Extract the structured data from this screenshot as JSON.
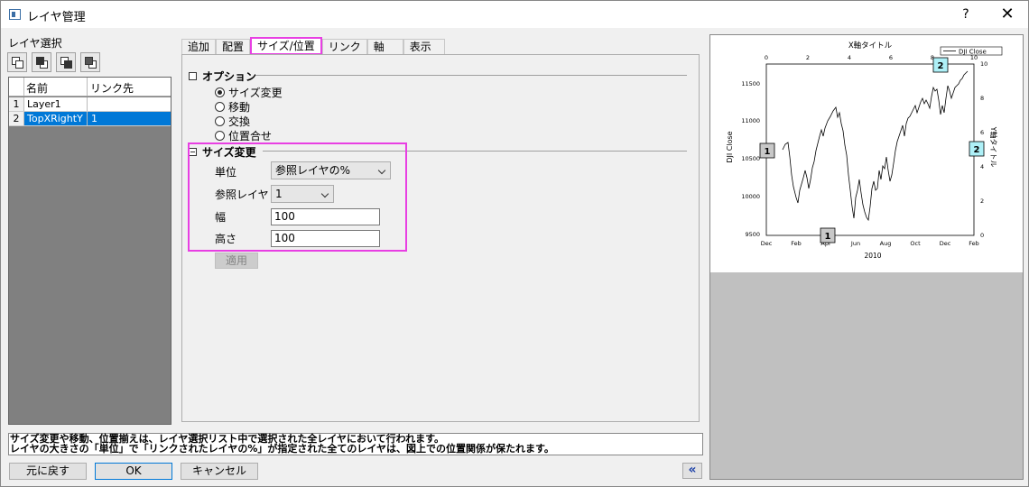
{
  "window": {
    "title": "レイヤ管理",
    "help": "?",
    "close": "✕"
  },
  "left": {
    "label": "レイヤ選択",
    "grid": {
      "headers": [
        "名前",
        "リンク先"
      ],
      "rows": [
        {
          "num": "1",
          "name": "Layer1",
          "link": ""
        },
        {
          "num": "2",
          "name": "TopXRightY",
          "link": "1"
        }
      ]
    }
  },
  "tabs": [
    "追加",
    "配置",
    "サイズ/位置",
    "リンク",
    "軸",
    "表示"
  ],
  "options": {
    "heading": "オプション",
    "items": [
      "サイズ変更",
      "移動",
      "交換",
      "位置合せ"
    ],
    "selected": 0
  },
  "resize": {
    "heading": "サイズ変更",
    "unit_label": "単位",
    "unit_value": "参照レイヤの%",
    "ref_label": "参照レイヤ",
    "ref_value": "1",
    "width_label": "幅",
    "width_value": "100",
    "height_label": "高さ",
    "height_value": "100",
    "apply": "適用"
  },
  "message": {
    "line1": "サイズ変更や移動、位置揃えは、レイヤ選択リスト中で選択された全レイヤにおいて行われます。",
    "line2": "レイヤの大きさの「単位」で「リンクされたレイヤの%」が指定された全てのレイヤは、図上での位置関係が保たれます。"
  },
  "buttons": {
    "reset": "元に戻す",
    "ok": "OK",
    "cancel": "キャンセル",
    "collapse": "«"
  },
  "preview": {
    "top_axis_title": "X軸タイトル",
    "legend": "DJI Close",
    "left_axis_title": "DJI Close",
    "right_axis_title": "Y軸タイトル",
    "bottom_axis_title": "2010",
    "left_ticks": [
      "11500",
      "11000",
      "10500",
      "10000",
      "9500"
    ],
    "right_ticks": [
      "10",
      "8",
      "6",
      "4",
      "2",
      "0"
    ],
    "top_ticks": [
      "0",
      "2",
      "4",
      "6",
      "8",
      "10"
    ],
    "bottom_ticks": [
      "Dec",
      "Feb",
      "Apr",
      "Jun",
      "Aug",
      "Oct",
      "Dec",
      "Feb"
    ],
    "layer1_tag": "1",
    "layer2_tag": "2",
    "colors": {
      "layer2_tag": "#aef0f7",
      "layer1_tag": "#c8c8c8"
    }
  }
}
